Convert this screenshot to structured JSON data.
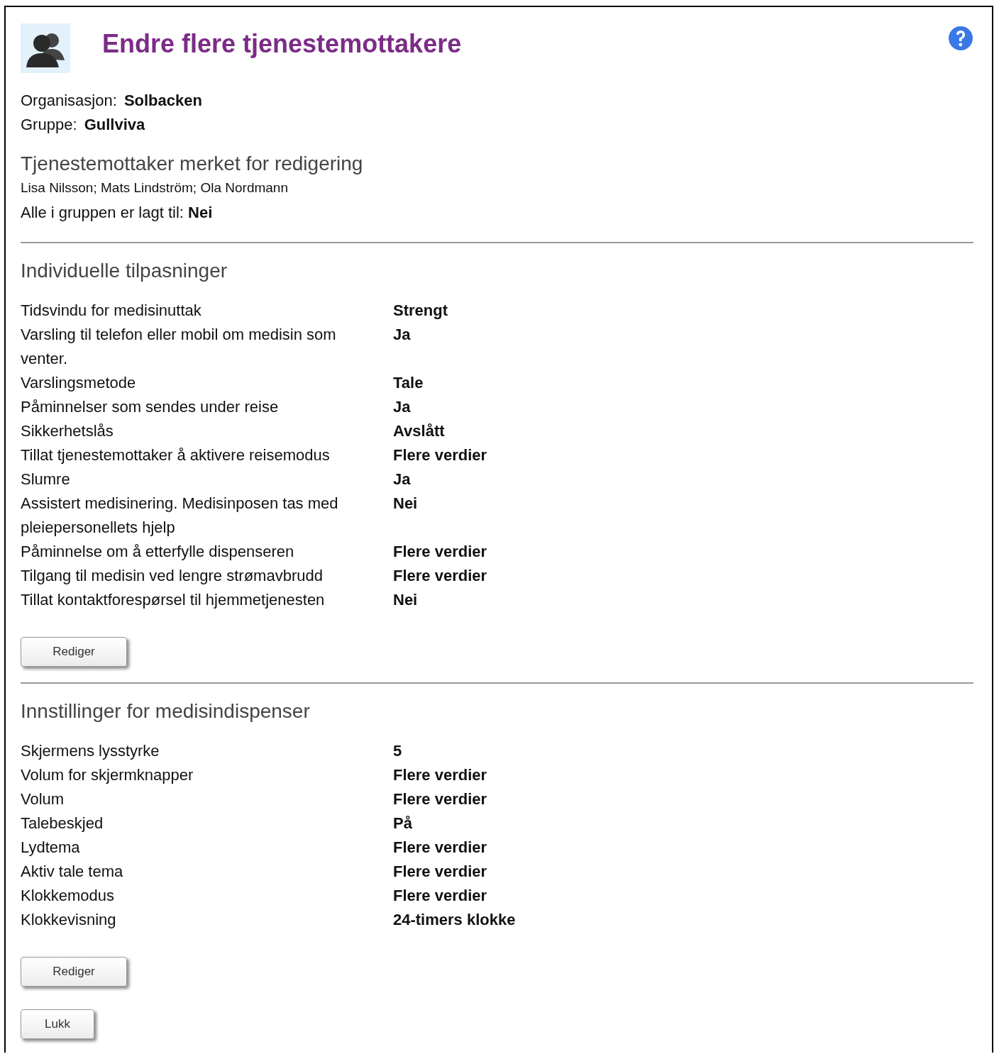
{
  "header": {
    "title": "Endre flere tjenestemottakere"
  },
  "info": [
    {
      "label": "Organisasjon:",
      "value": "Solbacken"
    },
    {
      "label": "Gruppe:",
      "value": "Gullviva"
    }
  ],
  "marked": {
    "heading": "Tjenestemottaker merket for redigering",
    "names": "Lisa Nilsson; Mats Lindström; Ola Nordmann",
    "all_label": "Alle i gruppen er lagt til:",
    "all_value": "Nei"
  },
  "sections": [
    {
      "title": "Individuelle tilpasninger",
      "button": "Rediger",
      "rows": [
        {
          "label": "Tidsvindu for medisinuttak",
          "value": "Strengt"
        },
        {
          "label": "Varsling til telefon eller mobil om medisin som venter.",
          "value": "Ja"
        },
        {
          "label": "Varslingsmetode",
          "value": "Tale"
        },
        {
          "label": "Påminnelser som sendes under reise",
          "value": "Ja"
        },
        {
          "label": "Sikkerhetslås",
          "value": "Avslått"
        },
        {
          "label": "Tillat tjenestemottaker å aktivere reisemodus",
          "value": "Flere verdier"
        },
        {
          "label": "Slumre",
          "value": "Ja"
        },
        {
          "label": "Assistert medisinering. Medisinposen tas med pleiepersonellets hjelp",
          "value": "Nei"
        },
        {
          "label": "Påminnelse om å etterfylle dispenseren",
          "value": "Flere verdier"
        },
        {
          "label": "Tilgang til medisin ved lengre strømavbrudd",
          "value": "Flere verdier"
        },
        {
          "label": "Tillat kontaktforespørsel til hjemmetjenesten",
          "value": "Nei"
        }
      ]
    },
    {
      "title": "Innstillinger for medisindispenser",
      "button": "Rediger",
      "rows": [
        {
          "label": "Skjermens lysstyrke",
          "value": "5"
        },
        {
          "label": "Volum for skjermknapper",
          "value": "Flere verdier"
        },
        {
          "label": "Volum",
          "value": "Flere verdier"
        },
        {
          "label": "Talebeskjed",
          "value": "På"
        },
        {
          "label": "Lydtema",
          "value": "Flere verdier"
        },
        {
          "label": "Aktiv tale tema",
          "value": "Flere verdier"
        },
        {
          "label": "Klokkemodus",
          "value": "Flere verdier"
        },
        {
          "label": "Klokkevisning",
          "value": "24-timers klokke"
        }
      ]
    }
  ],
  "close_button": "Lukk"
}
